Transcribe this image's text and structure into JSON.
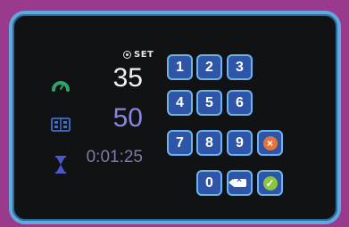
{
  "display": {
    "set_label": "SET",
    "speed_value": "35",
    "set_value": "50",
    "timer_value": "0:01:25"
  },
  "keypad": {
    "keys": [
      "1",
      "2",
      "3",
      "4",
      "5",
      "6",
      "7",
      "8",
      "9",
      "0"
    ]
  },
  "icons": {
    "speed": "speed-gauge-icon",
    "switch": "switch-icon",
    "timer": "hourglass-icon",
    "set": "target-icon",
    "backspace": "backspace-icon",
    "cancel": "cancel-icon",
    "confirm": "check-icon"
  },
  "colors": {
    "background": "#9a3a8c",
    "bezel": "#5ea9de",
    "screen": "#111214",
    "key_fill": "#2f55a8",
    "key_border": "#6eb3ea",
    "set_value": "#8a86e0",
    "cancel": "#e8733a",
    "confirm": "#8cc63f",
    "speed_icon": "#2fa36a"
  }
}
